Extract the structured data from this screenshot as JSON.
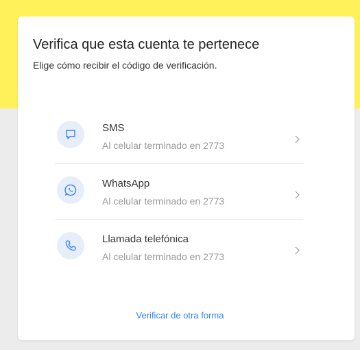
{
  "page": {
    "title": "Verifica que esta cuenta te pertenece",
    "subtitle": "Elige cómo recibir el código de verificación."
  },
  "options": [
    {
      "icon": "sms-icon",
      "title": "SMS",
      "detail": "Al celular terminado en 2773"
    },
    {
      "icon": "whatsapp-icon",
      "title": "WhatsApp",
      "detail": "Al celular terminado en 2773"
    },
    {
      "icon": "phone-icon",
      "title": "Llamada telefónica",
      "detail": "Al celular terminado en 2773"
    }
  ],
  "footer": {
    "alt_link": "Verificar de otra forma"
  },
  "colors": {
    "header_yellow": "#fff159",
    "accent_blue": "#3483fa",
    "icon_bg": "#e8eef9",
    "background": "#ececec"
  }
}
